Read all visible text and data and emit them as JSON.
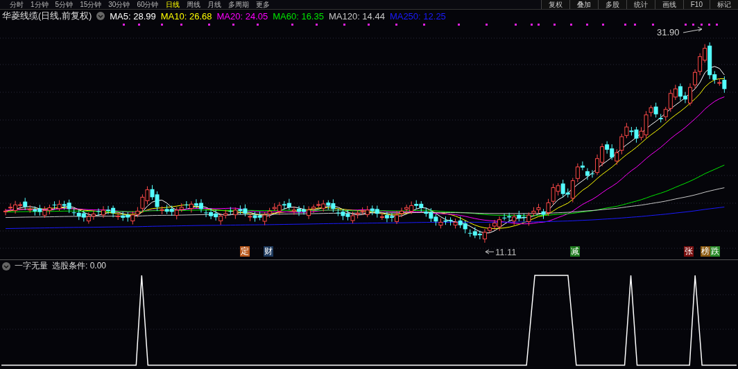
{
  "toolbar": {
    "periods": [
      {
        "label": "分时",
        "selected": false
      },
      {
        "label": "1分钟",
        "selected": false
      },
      {
        "label": "5分钟",
        "selected": false
      },
      {
        "label": "15分钟",
        "selected": false
      },
      {
        "label": "30分钟",
        "selected": false
      },
      {
        "label": "60分钟",
        "selected": false
      },
      {
        "label": "日线",
        "selected": true
      },
      {
        "label": "周线",
        "selected": false
      },
      {
        "label": "月线",
        "selected": false
      },
      {
        "label": "多周期",
        "selected": false
      },
      {
        "label": "更多",
        "selected": false
      }
    ],
    "tools": [
      "复权",
      "叠加",
      "多股",
      "统计",
      "画线",
      "F10",
      "标记"
    ]
  },
  "legend": {
    "title": "华菱线缆(日线,前复权)",
    "indicators": [
      {
        "label": "MA5: 28.99",
        "color": "#ffffff"
      },
      {
        "label": "MA10: 26.68",
        "color": "#ffff00"
      },
      {
        "label": "MA20: 24.05",
        "color": "#ff00ff"
      },
      {
        "label": "MA60: 16.35",
        "color": "#00e600"
      },
      {
        "label": "MA120: 14.44",
        "color": "#c8c8c8"
      },
      {
        "label": "MA250: 12.25",
        "color": "#1a1aff"
      }
    ]
  },
  "price_marks": {
    "high": "31.90",
    "low": "11.11"
  },
  "event_tags": [
    {
      "label": "定",
      "color": "#b8581c"
    },
    {
      "label": "财",
      "color": "#1e3a5e"
    },
    {
      "label": "减",
      "color": "#1e7a1e"
    },
    {
      "label": "张",
      "color": "#7a1010"
    },
    {
      "label": "榜",
      "color": "#8a5a10"
    },
    {
      "label": "跌",
      "color": "#2a8a2a"
    }
  ],
  "indicator_panel": {
    "title": "一字无量",
    "reading": "选股条件: 0.00"
  }
}
